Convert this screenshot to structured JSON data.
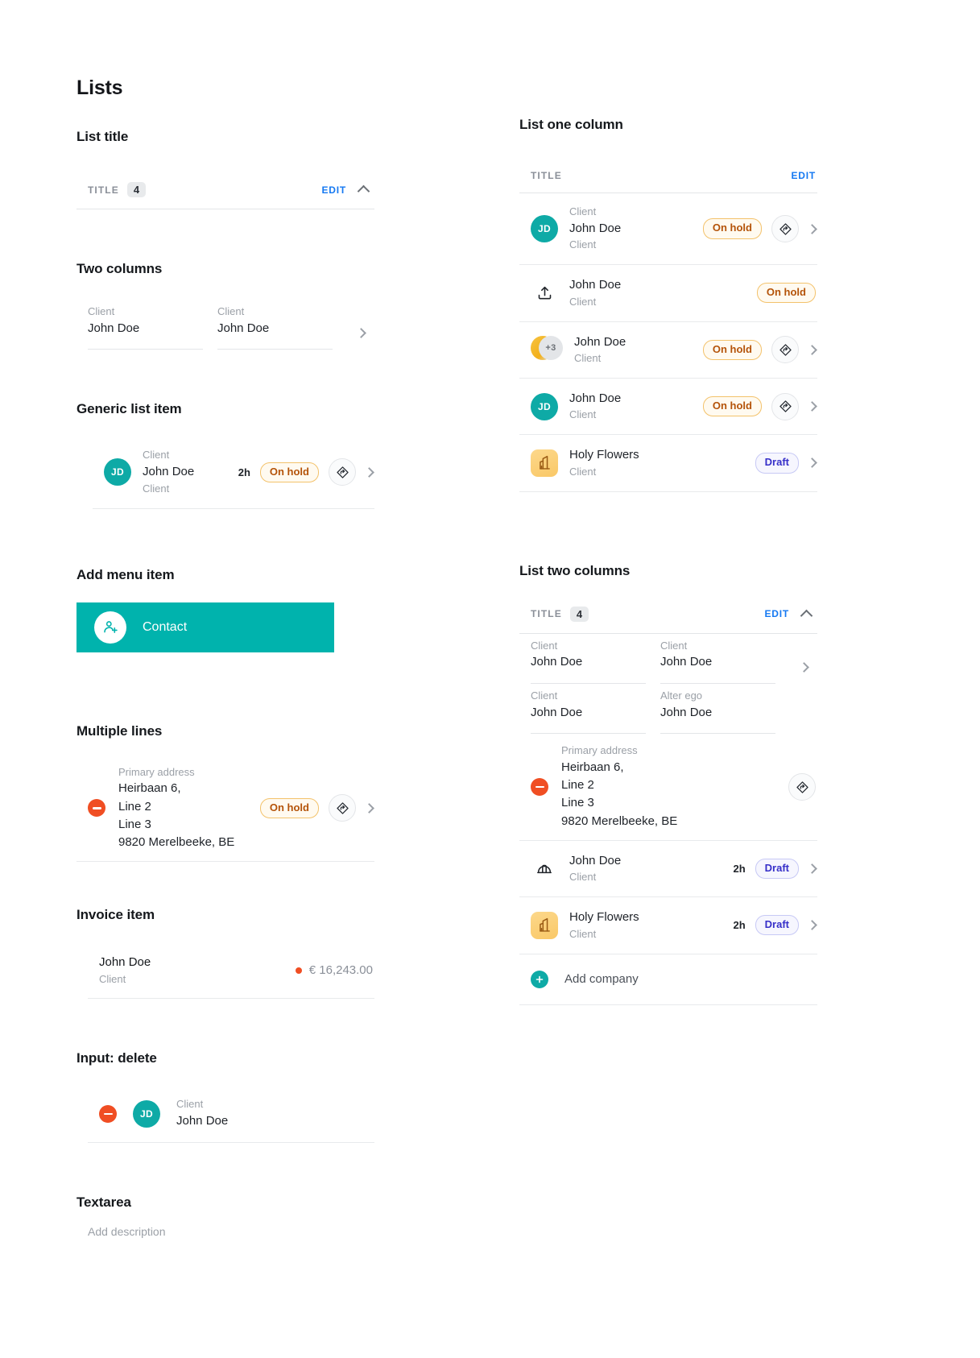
{
  "page": {
    "title": "Lists"
  },
  "left": {
    "sections": {
      "list_title": "List title",
      "two_columns": "Two columns",
      "generic_list_item": "Generic list item",
      "add_menu_item": "Add menu item",
      "multiple_lines": "Multiple lines",
      "invoice_item": "Invoice item",
      "input_delete": "Input: delete",
      "textarea": "Textarea"
    },
    "list_header": {
      "title": "TITLE",
      "count": "4",
      "edit": "EDIT"
    },
    "two_columns_row": {
      "left": {
        "label": "Client",
        "value": "John Doe"
      },
      "right": {
        "label": "Client",
        "value": "John Doe"
      }
    },
    "generic_item": {
      "avatar_initials": "JD",
      "label": "Client",
      "value": "John Doe",
      "sub": "Client",
      "time": "2h",
      "badge": "On hold"
    },
    "cta": {
      "label": "Contact",
      "icon": "person-add-icon"
    },
    "multiple_lines": {
      "label": "Primary address",
      "lines": [
        "Heirbaan 6,",
        "Line 2",
        "Line 3",
        "9820 Merelbeeke, BE"
      ],
      "badge": "On hold"
    },
    "invoice": {
      "name": "John Doe",
      "sub": "Client",
      "amount": "€ 16,243.00"
    },
    "input_delete": {
      "avatar_initials": "JD",
      "label": "Client",
      "value": "John Doe"
    },
    "textarea": {
      "placeholder": "Add description"
    }
  },
  "right": {
    "sections": {
      "list_one_column": "List one column",
      "list_two_columns": "List two columns"
    },
    "one_column": {
      "header": {
        "title": "TITLE",
        "edit": "EDIT"
      },
      "rows": [
        {
          "icon": "avatar-initials",
          "initials": "JD",
          "label": "Client",
          "title": "John Doe",
          "sub": "Client",
          "badge": "On hold",
          "badge_type": "hold",
          "action": true,
          "chevron": true
        },
        {
          "icon": "upload-icon",
          "label": "",
          "title": "John Doe",
          "sub": "Client",
          "badge": "On hold",
          "badge_type": "hold",
          "action": false,
          "chevron": false
        },
        {
          "icon": "avatar-group",
          "group_count": "+3",
          "label": "",
          "title": "John Doe",
          "sub": "Client",
          "badge": "On hold",
          "badge_type": "hold",
          "action": true,
          "chevron": true
        },
        {
          "icon": "avatar-initials",
          "initials": "JD",
          "label": "",
          "title": "John Doe",
          "sub": "Client",
          "badge": "On hold",
          "badge_type": "hold",
          "action": true,
          "chevron": true
        },
        {
          "icon": "building-icon",
          "label": "",
          "title": "Holy Flowers",
          "sub": "Client",
          "badge": "Draft",
          "badge_type": "draft",
          "action": false,
          "chevron": true
        }
      ]
    },
    "two_columns": {
      "header": {
        "title": "TITLE",
        "count": "4",
        "edit": "EDIT"
      },
      "field_rows": [
        {
          "left_label": "Client",
          "left_value": "John Doe",
          "right_label": "Client",
          "right_value": "John Doe",
          "chevron": true
        },
        {
          "left_label": "Client",
          "left_value": "John Doe",
          "right_label": "Alter ego",
          "right_value": "John Doe",
          "chevron": false
        }
      ],
      "address_row": {
        "label": "Primary address",
        "lines": [
          "Heirbaan 6,",
          "Line 2",
          "Line 3",
          "9820 Merelbeeke, BE"
        ]
      },
      "rows": [
        {
          "icon": "hardhat-icon",
          "title": "John Doe",
          "sub": "Client",
          "time": "2h",
          "badge": "Draft",
          "badge_type": "draft"
        },
        {
          "icon": "building-icon",
          "title": "Holy Flowers",
          "sub": "Client",
          "time": "2h",
          "badge": "Draft",
          "badge_type": "draft"
        }
      ],
      "add_row": {
        "label": "Add company",
        "icon": "plus-icon"
      }
    }
  },
  "colors": {
    "accent_teal": "#00b3ad",
    "avatar_teal": "#0eaaa6",
    "link_blue": "#1579f2",
    "hold_amber": "#b45309",
    "draft_indigo": "#3730c9",
    "delete_orange": "#f04e23"
  }
}
